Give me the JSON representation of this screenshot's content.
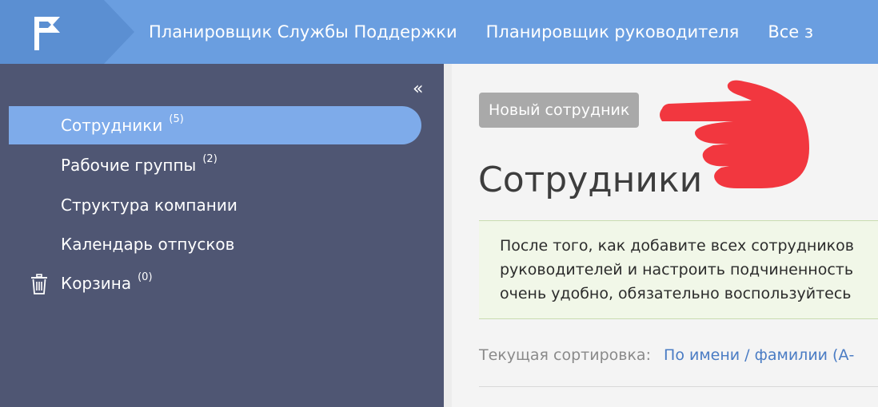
{
  "header": {
    "logo_icon": "flag-logo-icon",
    "nav_links": [
      "Планировщик Службы Поддержки",
      "Планировщик руководителя",
      "Все з"
    ],
    "colors": {
      "bar": "#6a9ee0",
      "logo_box": "#5b8fd2"
    }
  },
  "sidebar": {
    "collapse_icon": "«",
    "items": [
      {
        "label": "Сотрудники",
        "count": "(5)",
        "active": true
      },
      {
        "label": "Рабочие группы",
        "count": "(2)"
      },
      {
        "label": "Структура компании",
        "count": ""
      },
      {
        "label": "Календарь отпусков",
        "count": ""
      },
      {
        "label": "Корзина",
        "count": "(0)",
        "icon": "trash-icon"
      }
    ],
    "colors": {
      "background": "#4f5673",
      "active": "#7eabea"
    }
  },
  "main": {
    "new_employee_button": "Новый сотрудник",
    "pointer_icon": "pointing-hand-icon",
    "title": "Сотрудники",
    "notice_lines": [
      "После того, как добавите всех сотрудников",
      "руководителей и настроить подчиненность",
      "очень удобно, обязательно воспользуйтесь"
    ],
    "sort_label": "Текущая сортировка:",
    "sort_value": "По имени / фамилии (А-"
  }
}
